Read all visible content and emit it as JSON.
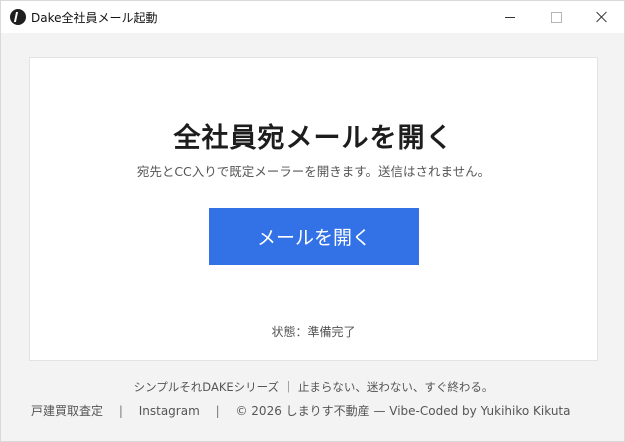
{
  "window": {
    "title": "Dake全社員メール起動",
    "app_icon": "app-logo-icon",
    "controls": {
      "minimize": "minimize-icon",
      "maximize": "maximize-icon",
      "close": "close-icon"
    }
  },
  "main": {
    "heading": "全社員宛メールを開く",
    "description": "宛先とCC入りで既定メーラーを開きます。送信はされません。",
    "open_button_label": "メールを開く",
    "status": "状態：準備完了"
  },
  "footer": {
    "tagline": "シンプルそれDAKEシリーズ ｜ 止まらない、迷わない、すぐ終わる。",
    "links": [
      "戸建買取査定",
      "Instagram"
    ],
    "separator": "|",
    "copyright": "© 2026 しまりす不動産 — Vibe-Coded by Yukihiko Kikuta"
  },
  "colors": {
    "accent": "#3271e6"
  }
}
